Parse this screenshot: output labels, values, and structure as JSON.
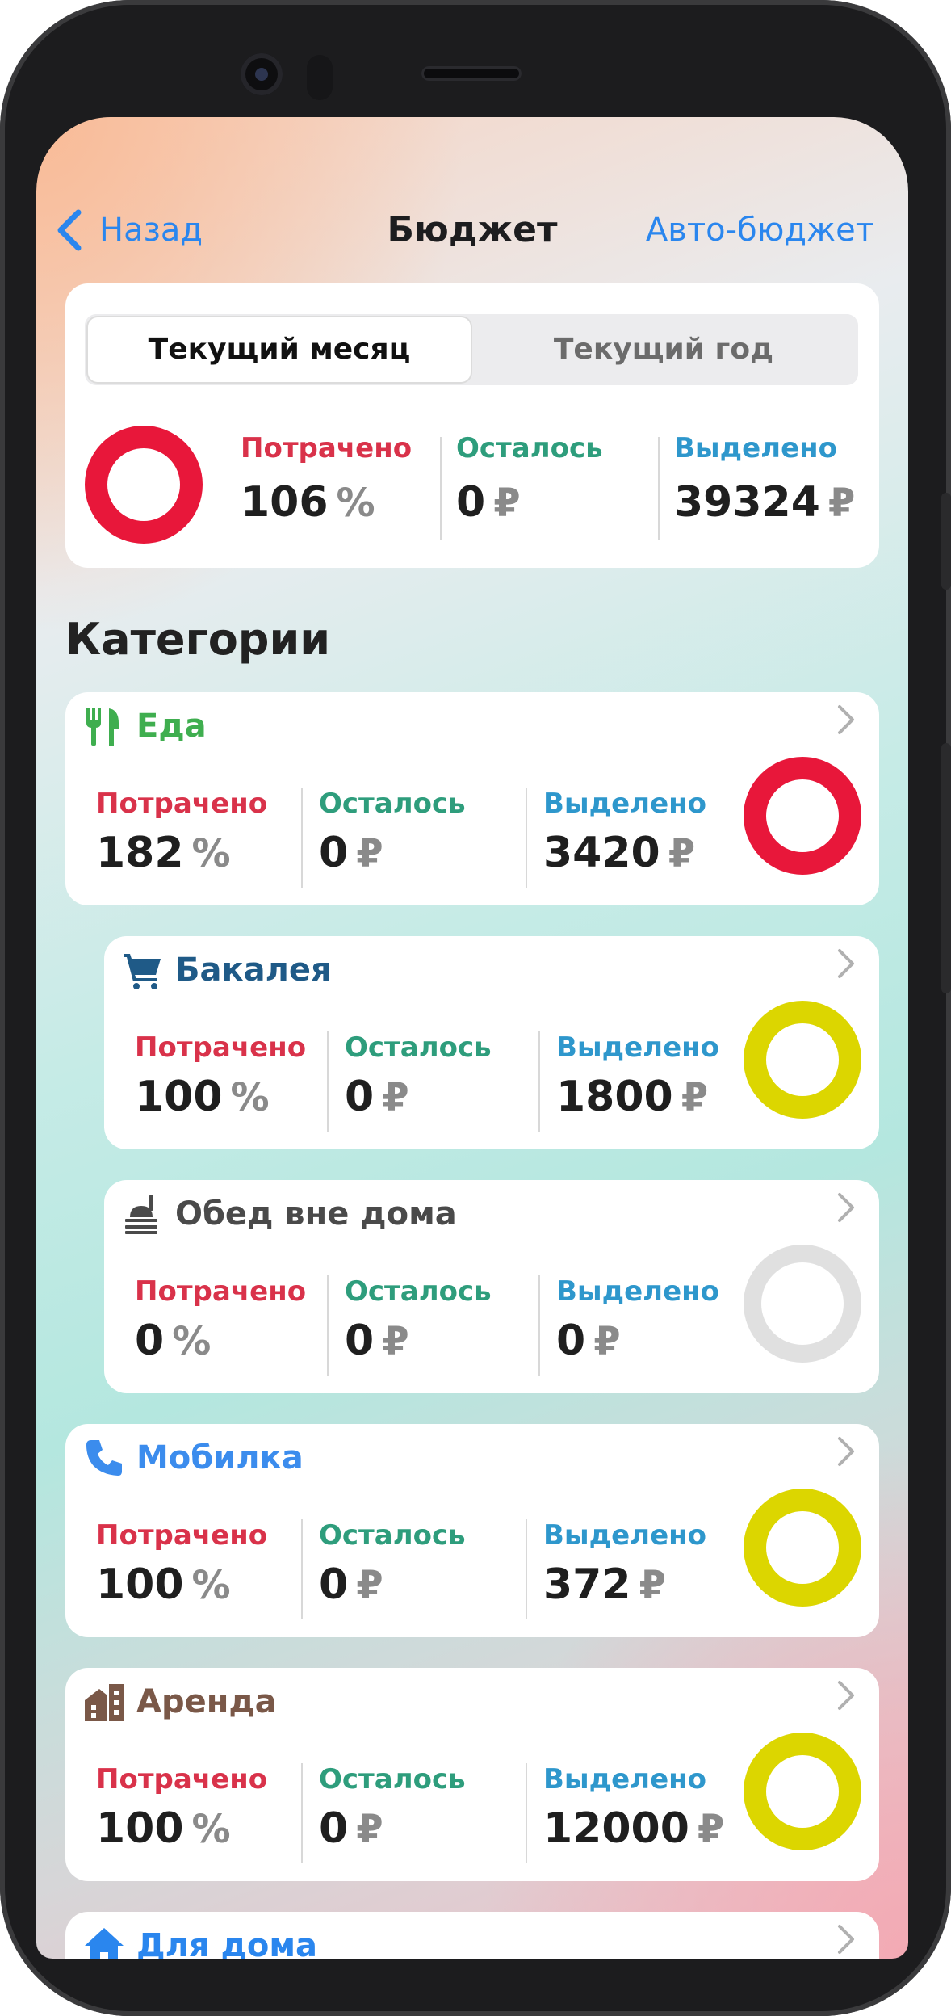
{
  "header": {
    "back_label": "Назад",
    "title": "Бюджет",
    "auto_label": "Авто-бюджет"
  },
  "summary": {
    "tabs": [
      {
        "label": "Текущий месяц",
        "active": true
      },
      {
        "label": "Текущий год",
        "active": false
      }
    ],
    "ring_color": "#e8173a",
    "spent_label": "Потрачено",
    "spent_value": "106",
    "spent_unit": "%",
    "left_label": "Осталось",
    "left_value": "0",
    "left_unit": "₽",
    "allocated_label": "Выделено",
    "allocated_value": "39324",
    "allocated_unit": "₽"
  },
  "section_title": "Категории",
  "colors": {
    "accent": "#2a86ee",
    "spent": "#d9324a",
    "left": "#2e9d7c",
    "allocated": "#2e97cc"
  },
  "categories": [
    {
      "name": "Еда",
      "icon": "utensils-icon",
      "color": "#3fae4f",
      "ring": "#e8173a",
      "spent_label": "Потрачено",
      "spent_value": "182",
      "spent_unit": "%",
      "left_label": "Осталось",
      "left_value": "0",
      "left_unit": "₽",
      "allocated_label": "Выделено",
      "allocated_value": "3420",
      "allocated_unit": "₽"
    },
    {
      "name": "Бакалея",
      "icon": "cart-icon",
      "color": "#1f5a87",
      "ring": "#dcd600",
      "spent_label": "Потрачено",
      "spent_value": "100",
      "spent_unit": "%",
      "left_label": "Осталось",
      "left_value": "0",
      "left_unit": "₽",
      "allocated_label": "Выделено",
      "allocated_value": "1800",
      "allocated_unit": "₽"
    },
    {
      "name": "Обед вне дома",
      "icon": "dining-icon",
      "color": "#4a4a4a",
      "ring": "#e0e0e0",
      "spent_label": "Потрачено",
      "spent_value": "0",
      "spent_unit": "%",
      "left_label": "Осталось",
      "left_value": "0",
      "left_unit": "₽",
      "allocated_label": "Выделено",
      "allocated_value": "0",
      "allocated_unit": "₽"
    },
    {
      "name": "Мобилка",
      "icon": "phone-icon",
      "color": "#3b8ced",
      "ring": "#dcd600",
      "spent_label": "Потрачено",
      "spent_value": "100",
      "spent_unit": "%",
      "left_label": "Осталось",
      "left_value": "0",
      "left_unit": "₽",
      "allocated_label": "Выделено",
      "allocated_value": "372",
      "allocated_unit": "₽"
    },
    {
      "name": "Аренда",
      "icon": "building-icon",
      "color": "#7a5848",
      "ring": "#dcd600",
      "spent_label": "Потрачено",
      "spent_value": "100",
      "spent_unit": "%",
      "left_label": "Осталось",
      "left_value": "0",
      "left_unit": "₽",
      "allocated_label": "Выделено",
      "allocated_value": "12000",
      "allocated_unit": "₽"
    },
    {
      "name": "Для дома",
      "icon": "home-icon",
      "color": "#2a86ee"
    }
  ]
}
